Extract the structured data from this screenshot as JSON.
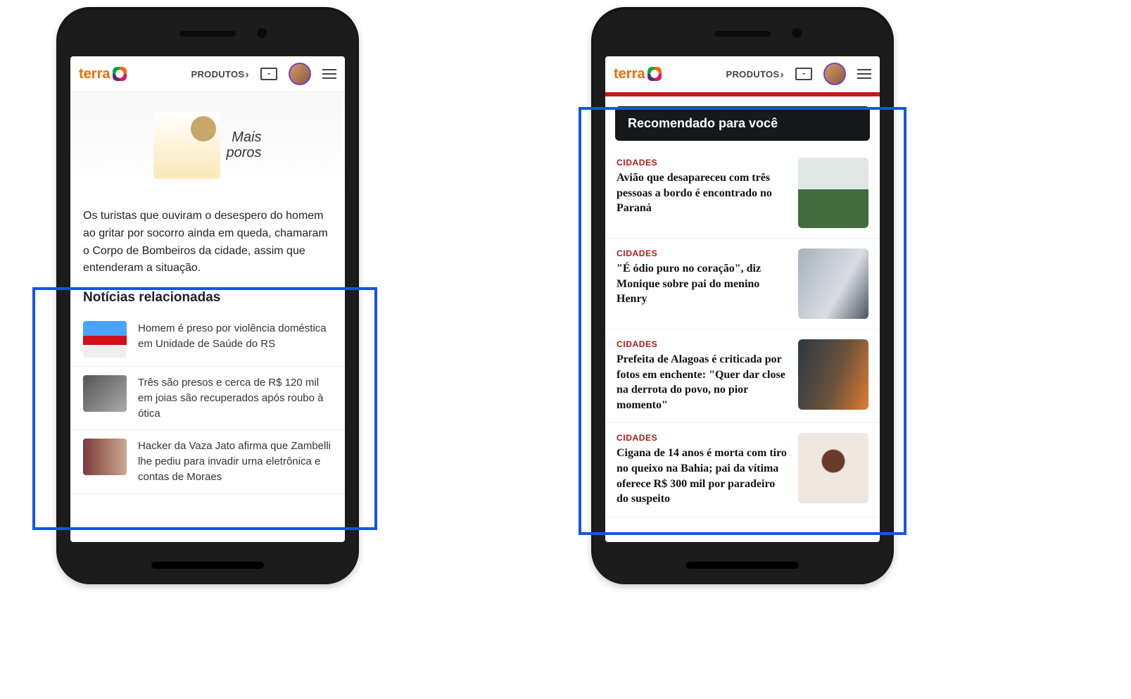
{
  "header": {
    "logo_text": "terra",
    "produtos": "PRODUTOS"
  },
  "ad": {
    "line1": "Mais",
    "line2": "poros"
  },
  "paragraph": "Os turistas que ouviram o desespero do homem ao gritar por socorro ainda em queda, chamaram o Corpo de Bombeiros da cidade, assim que entenderam a situação.",
  "related": {
    "heading": "Notícias relacionadas",
    "items": [
      "Homem é preso por violência doméstica em Unidade de Saúde do RS",
      "Três são presos e cerca de R$ 120 mil em joias são recuperados após roubo à ótica",
      "Hacker da Vaza Jato afirma que Zambelli lhe pediu para invadir urna eletrônica e contas de Moraes"
    ]
  },
  "recommend": {
    "heading": "Recomendado para você",
    "items": [
      {
        "cat": "CIDADES",
        "title": "Avião que desapareceu com três pessoas a bordo é encontrado no Paraná"
      },
      {
        "cat": "CIDADES",
        "title": "\"É ódio puro no coração\", diz Monique sobre pai do menino Henry"
      },
      {
        "cat": "CIDADES",
        "title": "Prefeita de Alagoas é criticada por fotos em enchente: \"Quer dar close na derrota do povo, no pior momento\""
      },
      {
        "cat": "CIDADES",
        "title": "Cigana de 14 anos é morta com tiro no queixo na Bahia; pai da vítima oferece R$ 300 mil por paradeiro do suspeito"
      }
    ]
  }
}
